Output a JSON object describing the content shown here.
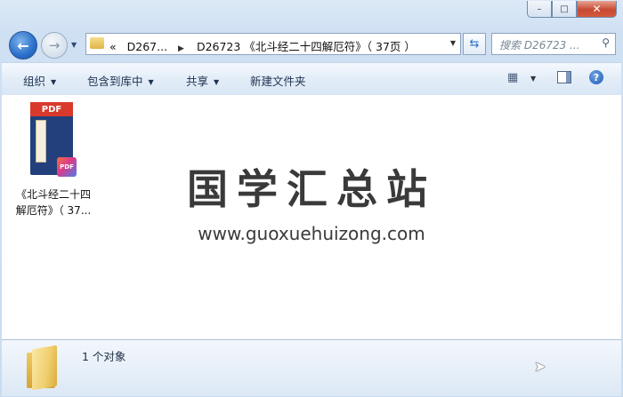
{
  "window": {
    "caption": {
      "min": "–",
      "max": "□",
      "close": "✕"
    }
  },
  "nav": {
    "back_icon": "←",
    "forward_icon": "→",
    "history_dropdown_icon": "▼",
    "breadcrumb": {
      "overflow": "«",
      "parent": "D267...",
      "separator": "▶",
      "current": "D26723 《北斗经二十四解厄符》（ 37页 ）"
    },
    "address_dropdown_icon": "▼",
    "refresh_icon": "⇆",
    "search_placeholder": "搜索 D26723 ...",
    "search_icon": "⚲"
  },
  "toolbar": {
    "organize": "组织",
    "include_in_library": "包含到库中",
    "share": "共享",
    "new_folder": "新建文件夹",
    "dropdown_arrow": "▼",
    "view_icon": "▦",
    "help_icon": "?"
  },
  "files": [
    {
      "type": "pdf",
      "badge": "PDF",
      "name_line1": "《北斗经二十四",
      "name_line2": "解厄符》（ 37..."
    }
  ],
  "watermark": {
    "title": "国学汇总站",
    "url": "www.guoxuehuizong.com"
  },
  "status": {
    "object_count": "1 个对象"
  },
  "colors": {
    "frame": "#cfe0f3",
    "accent_blue": "#2a6fc9",
    "close_red": "#c74a32",
    "pdf_red": "#d8392b",
    "book_navy": "#23407c",
    "folder_yellow": "#efcf6d"
  }
}
